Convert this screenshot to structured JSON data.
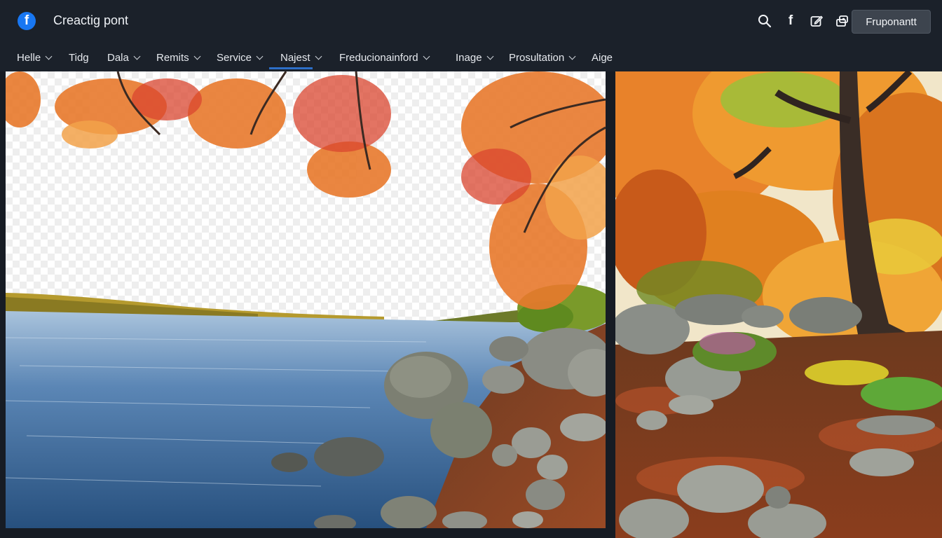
{
  "app": {
    "logo_letter": "f",
    "title": "Creactig pont"
  },
  "header": {
    "icons": [
      "search-icon",
      "facebook-icon",
      "edit-icon",
      "camera-icon"
    ],
    "action_button": "Fruponantt"
  },
  "nav": {
    "items": [
      {
        "label": "Helle",
        "has_dropdown": true
      },
      {
        "label": "Tidg",
        "has_dropdown": false
      },
      {
        "label": "Dala",
        "has_dropdown": true
      },
      {
        "label": "Remits",
        "has_dropdown": true
      },
      {
        "label": "Service",
        "has_dropdown": true
      },
      {
        "label": "Najest",
        "has_dropdown": true,
        "active": true
      },
      {
        "label": "Freducionainford",
        "has_dropdown": true
      },
      {
        "label": "Inage",
        "has_dropdown": true
      },
      {
        "label": "Prosultation",
        "has_dropdown": true
      },
      {
        "label": "Aige",
        "has_dropdown": false
      }
    ]
  },
  "images": [
    {
      "subject": "autumn lake shore with rocks, transparent sky"
    },
    {
      "subject": "autumn forest with orange trees and rocks"
    }
  ],
  "colors": {
    "accent": "#2d6fc8",
    "brand": "#1877f2",
    "bar": "#1b212a",
    "button": "#3d444e"
  }
}
